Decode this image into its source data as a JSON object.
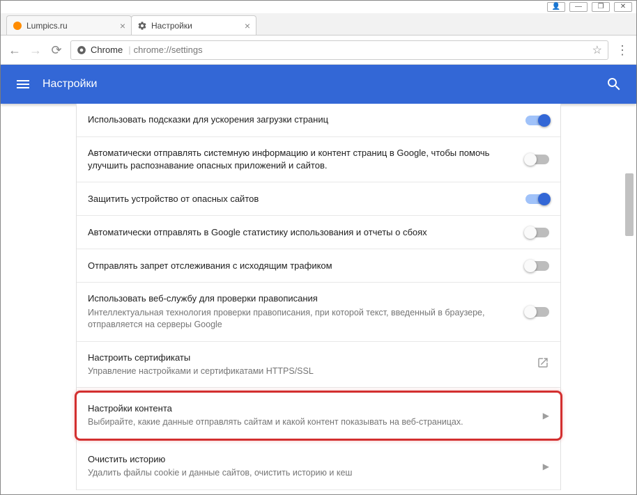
{
  "window": {
    "controls": {
      "user": "👤",
      "min": "—",
      "max": "❐",
      "close": "✕"
    }
  },
  "tabs": [
    {
      "title": "Lumpics.ru",
      "favicon_color": "#ff8c00"
    },
    {
      "title": "Настройки",
      "favicon": "gear"
    }
  ],
  "toolbar": {
    "back": "←",
    "forward": "→",
    "reload": "⟳",
    "prefix": "Chrome",
    "url": "chrome://settings",
    "star": "☆",
    "menu": "⋮"
  },
  "appbar": {
    "title": "Настройки"
  },
  "settings": [
    {
      "title": "Использовать подсказки для ускорения загрузки страниц",
      "toggle": "on"
    },
    {
      "title": "Автоматически отправлять системную информацию и контент страниц в Google, чтобы помочь улучшить распознавание опасных приложений и сайтов.",
      "toggle": "off"
    },
    {
      "title": "Защитить устройство от опасных сайтов",
      "toggle": "on"
    },
    {
      "title": "Автоматически отправлять в Google статистику использования и отчеты о сбоях",
      "toggle": "off"
    },
    {
      "title": "Отправлять запрет отслеживания с исходящим трафиком",
      "toggle": "off"
    },
    {
      "title": "Использовать веб-службу для проверки правописания",
      "sub": "Интеллектуальная технология проверки правописания, при которой текст, введенный в браузере, отправляется на серверы Google",
      "toggle": "off"
    },
    {
      "title": "Настроить сертификаты",
      "sub": "Управление настройками и сертификатами HTTPS/SSL",
      "action": "external"
    },
    {
      "title": "Настройки контента",
      "sub": "Выбирайте, какие данные отправлять сайтам и какой контент показывать на веб-страницах.",
      "action": "chevron",
      "highlight": true
    },
    {
      "title": "Очистить историю",
      "sub": "Удалить файлы cookie и данные сайтов, очистить историю и кеш",
      "action": "chevron"
    }
  ]
}
